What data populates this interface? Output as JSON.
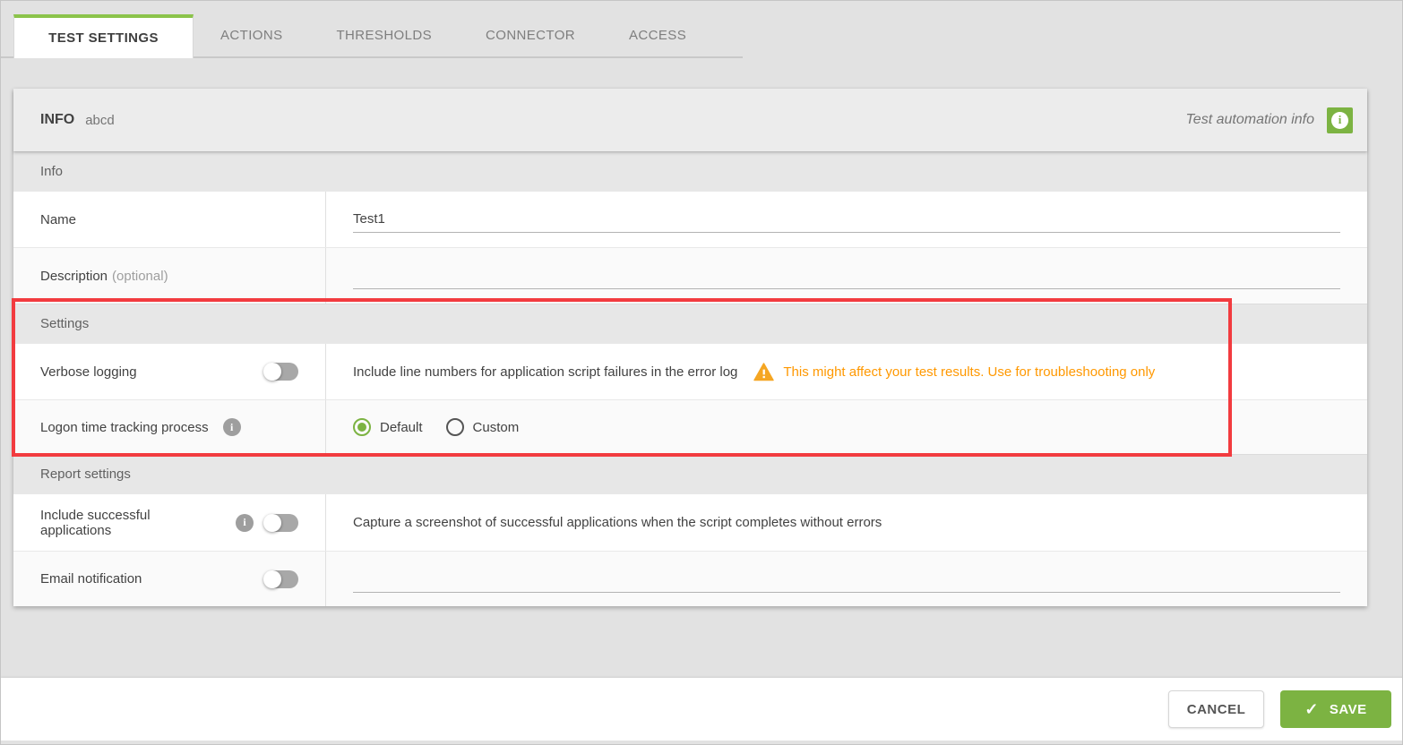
{
  "tabs": [
    {
      "label": "TEST SETTINGS",
      "active": true
    },
    {
      "label": "ACTIONS",
      "active": false
    },
    {
      "label": "THRESHOLDS",
      "active": false
    },
    {
      "label": "CONNECTOR",
      "active": false
    },
    {
      "label": "ACCESS",
      "active": false
    }
  ],
  "panel": {
    "title": "INFO",
    "subtitle": "abcd",
    "hint": "Test automation info",
    "hint_icon": "i",
    "sections": {
      "info": "Info",
      "settings": "Settings",
      "report": "Report settings"
    }
  },
  "form": {
    "name": {
      "label": "Name",
      "value": "Test1"
    },
    "description": {
      "label": "Description",
      "optional": "(optional)",
      "value": ""
    },
    "verbose": {
      "label": "Verbose logging",
      "enabled": false,
      "description": "Include line numbers for application script failures in the error log",
      "warning": "This might affect your test results. Use for troubleshooting only"
    },
    "logon": {
      "label": "Logon time tracking process",
      "info_icon": "i",
      "options": [
        {
          "label": "Default",
          "selected": true
        },
        {
          "label": "Custom",
          "selected": false
        }
      ]
    },
    "include_successful": {
      "label": "Include successful applications",
      "info_icon": "i",
      "enabled": false,
      "description": "Capture a screenshot of successful applications when the script completes without errors"
    },
    "email": {
      "label": "Email notification",
      "enabled": false,
      "value": ""
    }
  },
  "footer": {
    "cancel_label": "CANCEL",
    "save_label": "SAVE",
    "save_check": "✓"
  },
  "colors": {
    "accent_green": "#7cb342",
    "tab_green": "#8bc34a",
    "warning_orange": "#ff9800",
    "warning_icon": "#f5a623",
    "annotation_red": "#f23b3f"
  }
}
